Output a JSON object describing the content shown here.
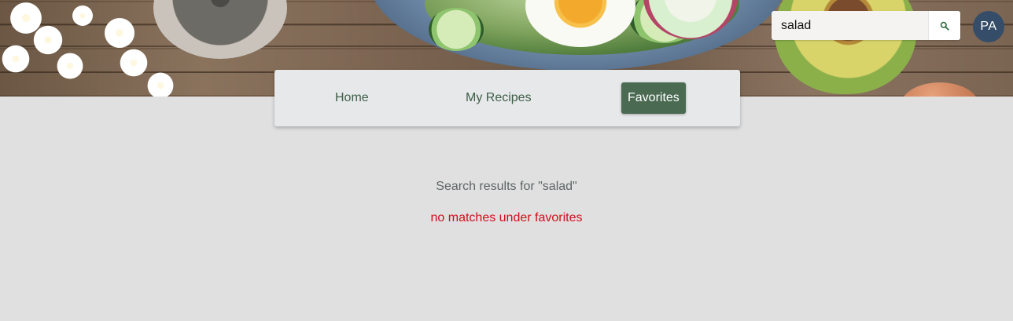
{
  "search": {
    "value": "salad",
    "placeholder": ""
  },
  "user": {
    "initials": "PA"
  },
  "nav": {
    "home_label": "Home",
    "recipes_label": "My Recipes",
    "favorites_label": "Favorites"
  },
  "results": {
    "heading": "Search results for \"salad\"",
    "message": "no matches under favorites"
  },
  "colors": {
    "accent": "#4a6a52",
    "avatar": "#354d68",
    "error": "#d0101b"
  },
  "icons": {
    "search": "magnifier-icon"
  }
}
